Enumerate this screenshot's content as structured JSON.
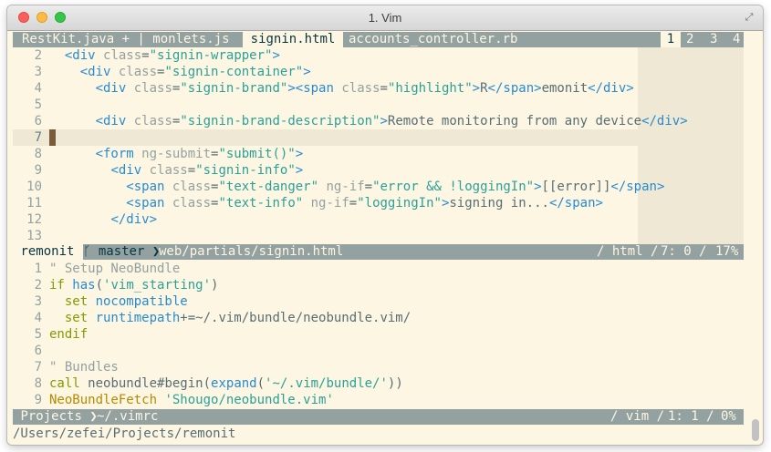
{
  "window": {
    "title": "1. Vim"
  },
  "tabs": [
    {
      "label": "RestKit.java + | monlets.js",
      "selected": false
    },
    {
      "label": "signin.html",
      "selected": true
    },
    {
      "label": "accounts_controller.rb",
      "selected": false
    }
  ],
  "tab_numbers": [
    "1",
    "2",
    "3",
    "4"
  ],
  "top_pane": {
    "lines": [
      {
        "n": "2",
        "tokens": [
          [
            "  ",
            "txt"
          ],
          [
            "<div ",
            "tag"
          ],
          [
            "class",
            "attr"
          ],
          [
            "=",
            "txt"
          ],
          [
            "\"signin-wrapper\"",
            "str"
          ],
          [
            ">",
            "tag"
          ]
        ]
      },
      {
        "n": "3",
        "tokens": [
          [
            "    ",
            "txt"
          ],
          [
            "<div ",
            "tag"
          ],
          [
            "class",
            "attr"
          ],
          [
            "=",
            "txt"
          ],
          [
            "\"signin-container\"",
            "str"
          ],
          [
            ">",
            "tag"
          ]
        ]
      },
      {
        "n": "4",
        "tokens": [
          [
            "      ",
            "txt"
          ],
          [
            "<div ",
            "tag"
          ],
          [
            "class",
            "attr"
          ],
          [
            "=",
            "txt"
          ],
          [
            "\"signin-brand\"",
            "str"
          ],
          [
            "><span ",
            "tag"
          ],
          [
            "class",
            "attr"
          ],
          [
            "=",
            "txt"
          ],
          [
            "\"highlight\"",
            "str"
          ],
          [
            ">",
            "tag"
          ],
          [
            "R",
            "txt"
          ],
          [
            "</span>",
            "tag"
          ],
          [
            "emonit",
            "txt"
          ],
          [
            "</div>",
            "tag"
          ]
        ]
      },
      {
        "n": "5",
        "tokens": []
      },
      {
        "n": "6",
        "tokens": [
          [
            "      ",
            "txt"
          ],
          [
            "<div ",
            "tag"
          ],
          [
            "class",
            "attr"
          ],
          [
            "=",
            "txt"
          ],
          [
            "\"signin-brand-description\"",
            "str"
          ],
          [
            ">",
            "tag"
          ],
          [
            "Remote monitoring from any device",
            "txt"
          ],
          [
            "</div>",
            "tag"
          ]
        ]
      },
      {
        "n": "7",
        "tokens": [],
        "current": true
      },
      {
        "n": "8",
        "tokens": [
          [
            "      ",
            "txt"
          ],
          [
            "<form ",
            "tag"
          ],
          [
            "ng-submit",
            "attr"
          ],
          [
            "=",
            "txt"
          ],
          [
            "\"submit()\"",
            "str"
          ],
          [
            ">",
            "tag"
          ]
        ]
      },
      {
        "n": "9",
        "tokens": [
          [
            "        ",
            "txt"
          ],
          [
            "<div ",
            "tag"
          ],
          [
            "class",
            "attr"
          ],
          [
            "=",
            "txt"
          ],
          [
            "\"signin-info\"",
            "str"
          ],
          [
            ">",
            "tag"
          ]
        ]
      },
      {
        "n": "10",
        "tokens": [
          [
            "          ",
            "txt"
          ],
          [
            "<span ",
            "tag"
          ],
          [
            "class",
            "attr"
          ],
          [
            "=",
            "txt"
          ],
          [
            "\"text-danger\"",
            "str"
          ],
          [
            " ",
            "txt"
          ],
          [
            "ng-if",
            "attr"
          ],
          [
            "=",
            "txt"
          ],
          [
            "\"error && !loggingIn\"",
            "str"
          ],
          [
            ">",
            "tag"
          ],
          [
            "[[error]]",
            "txt"
          ],
          [
            "</span>",
            "tag"
          ]
        ]
      },
      {
        "n": "11",
        "tokens": [
          [
            "          ",
            "txt"
          ],
          [
            "<span ",
            "tag"
          ],
          [
            "class",
            "attr"
          ],
          [
            "=",
            "txt"
          ],
          [
            "\"text-info\"",
            "str"
          ],
          [
            " ",
            "txt"
          ],
          [
            "ng-if",
            "attr"
          ],
          [
            "=",
            "txt"
          ],
          [
            "\"loggingIn\"",
            "str"
          ],
          [
            ">",
            "tag"
          ],
          [
            "signing in...",
            "txt"
          ],
          [
            "</span>",
            "tag"
          ]
        ]
      },
      {
        "n": "12",
        "tokens": [
          [
            "        ",
            "txt"
          ],
          [
            "</div>",
            "tag"
          ]
        ]
      },
      {
        "n": "13",
        "tokens": []
      }
    ]
  },
  "top_status": {
    "project": "remonit",
    "branch_icon": "branch-icon",
    "branch": "master",
    "path": "web/partials/signin.html",
    "filetype": "html",
    "position": "7: 0",
    "percent": "17%"
  },
  "bottom_pane": {
    "lines": [
      {
        "n": "1",
        "tokens": [
          [
            "\" Setup NeoBundle",
            "com"
          ]
        ]
      },
      {
        "n": "2",
        "tokens": [
          [
            "if ",
            "kw"
          ],
          [
            "has",
            "fn"
          ],
          [
            "(",
            "txt"
          ],
          [
            "'vim_starting'",
            "str"
          ],
          [
            ")",
            "txt"
          ]
        ]
      },
      {
        "n": "3",
        "tokens": [
          [
            "  ",
            "txt"
          ],
          [
            "set ",
            "kw"
          ],
          [
            "nocompatible",
            "fn"
          ]
        ]
      },
      {
        "n": "4",
        "tokens": [
          [
            "  ",
            "txt"
          ],
          [
            "set ",
            "kw"
          ],
          [
            "runtimepath",
            "fn"
          ],
          [
            "+=~/.vim/bundle/neobundle.vim/",
            "txt"
          ]
        ]
      },
      {
        "n": "5",
        "tokens": [
          [
            "endif",
            "kw"
          ]
        ]
      },
      {
        "n": "6",
        "tokens": []
      },
      {
        "n": "7",
        "tokens": [
          [
            "\" Bundles",
            "com"
          ]
        ]
      },
      {
        "n": "8",
        "tokens": [
          [
            "call ",
            "kw"
          ],
          [
            "neobundle#begin",
            "txt"
          ],
          [
            "(",
            "txt"
          ],
          [
            "expand",
            "fn"
          ],
          [
            "(",
            "txt"
          ],
          [
            "'~/.vim/bundle/'",
            "str"
          ],
          [
            "))",
            "txt"
          ]
        ]
      },
      {
        "n": "9",
        "tokens": [
          [
            "NeoBundleFetch ",
            "id"
          ],
          [
            "'Shougo/neobundle.vim'",
            "str"
          ]
        ]
      }
    ]
  },
  "bottom_status": {
    "project": "Projects",
    "path": "~/.vimrc",
    "filetype": "vim",
    "position": "1: 1",
    "percent": "0%"
  },
  "cmdline": {
    "text": "/Users/zefei/Projects/remonit"
  },
  "colors": {
    "base03": "#002b36",
    "base02": "#073642",
    "base01": "#586e75",
    "base1": "#93a1a1",
    "base2": "#eee8d5",
    "base3": "#fdf6e3",
    "blue": "#268bd2",
    "cyan": "#2aa198",
    "green": "#859900",
    "yellow": "#b58900"
  }
}
